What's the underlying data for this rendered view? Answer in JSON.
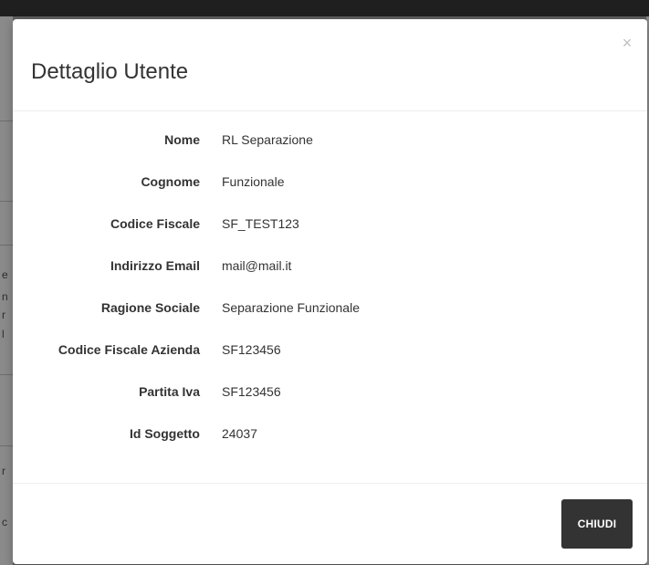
{
  "background": {
    "fragments": [
      "e",
      "n",
      "r",
      "l",
      "r",
      "c"
    ]
  },
  "modal": {
    "title": "Dettaglio Utente",
    "close_symbol": "×",
    "rows": [
      {
        "label": "Nome",
        "value": "RL Separazione"
      },
      {
        "label": "Cognome",
        "value": "Funzionale"
      },
      {
        "label": "Codice Fiscale",
        "value": "SF_TEST123"
      },
      {
        "label": "Indirizzo Email",
        "value": "mail@mail.it"
      },
      {
        "label": "Ragione Sociale",
        "value": "Separazione Funzionale"
      },
      {
        "label": "Codice Fiscale Azienda",
        "value": "SF123456"
      },
      {
        "label": "Partita Iva",
        "value": "SF123456"
      },
      {
        "label": "Id Soggetto",
        "value": "24037"
      }
    ],
    "footer": {
      "close_label": "CHIUDI"
    }
  },
  "colors": {
    "overlay": "#5f5f5f",
    "modal_background": "#ffffff",
    "text": "#333333",
    "button_background": "#333333",
    "button_text": "#ffffff",
    "close_icon": "#bfbfbf"
  }
}
